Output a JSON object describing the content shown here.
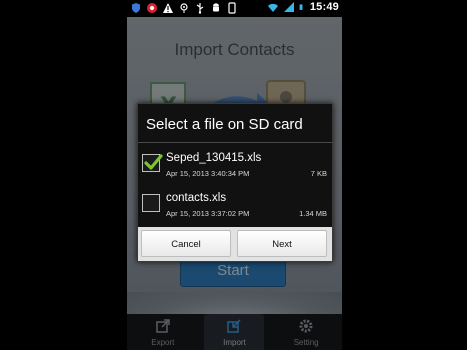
{
  "status_bar": {
    "time": "15:49",
    "icons": [
      "shield-icon",
      "record-icon",
      "warning-icon",
      "ant-icon",
      "usb-icon",
      "android-icon",
      "phone-icon",
      "wifi-icon",
      "signal-icon",
      "battery-icon"
    ]
  },
  "app": {
    "title": "Import Contacts",
    "start_label": "Start",
    "tabs": [
      {
        "label": "Export",
        "icon": "export-icon"
      },
      {
        "label": "Import",
        "icon": "import-icon"
      },
      {
        "label": "Setting",
        "icon": "gear-icon"
      }
    ]
  },
  "dialog": {
    "title": "Select a file on SD card",
    "files": [
      {
        "name": "Seped_130415.xls",
        "date": "Apr 15, 2013 3:40:34 PM",
        "size": "7 KB",
        "checked": true
      },
      {
        "name": "contacts.xls",
        "date": "Apr 15, 2013 3:37:02 PM",
        "size": "1.34 MB",
        "checked": false
      }
    ],
    "cancel_label": "Cancel",
    "next_label": "Next"
  },
  "colors": {
    "accent_check": "#7bc62d",
    "start_button": "#2f7fc0",
    "dialog_bg": "#111111"
  }
}
